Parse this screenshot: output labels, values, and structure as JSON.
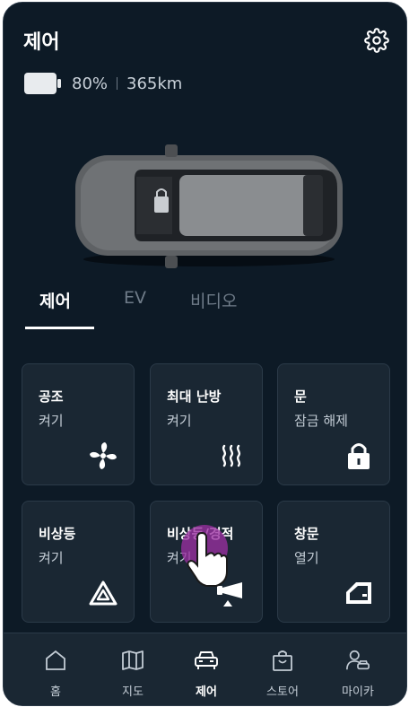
{
  "header": {
    "title": "제어"
  },
  "vehicle": {
    "battery_percent": "80%",
    "range": "365km"
  },
  "tabs": [
    {
      "label": "제어",
      "active": true
    },
    {
      "label": "EV",
      "active": false
    },
    {
      "label": "비디오",
      "active": false
    }
  ],
  "tiles": [
    {
      "title": "공조",
      "subtitle": "켜기",
      "icon": "fan-icon"
    },
    {
      "title": "최대 난방",
      "subtitle": "켜기",
      "icon": "seat-heat-icon"
    },
    {
      "title": "문",
      "subtitle": "잠금 해제",
      "icon": "lock-icon"
    },
    {
      "title": "비상등",
      "subtitle": "켜기",
      "icon": "hazard-triangle-icon"
    },
    {
      "title": "비상등/경적",
      "subtitle": "켜기",
      "icon": "horn-icon"
    },
    {
      "title": "창문",
      "subtitle": "열기",
      "icon": "window-icon"
    }
  ],
  "nav": [
    {
      "label": "홈",
      "icon": "home-icon",
      "active": false
    },
    {
      "label": "지도",
      "icon": "map-icon",
      "active": false
    },
    {
      "label": "제어",
      "icon": "car-icon",
      "active": true
    },
    {
      "label": "스토어",
      "icon": "shopping-bag-icon",
      "active": false
    },
    {
      "label": "마이카",
      "icon": "user-car-icon",
      "active": false
    }
  ],
  "colors": {
    "background": "#0d1a26",
    "tile": "#1a2733",
    "accent_tap": "#9a2fa0"
  }
}
